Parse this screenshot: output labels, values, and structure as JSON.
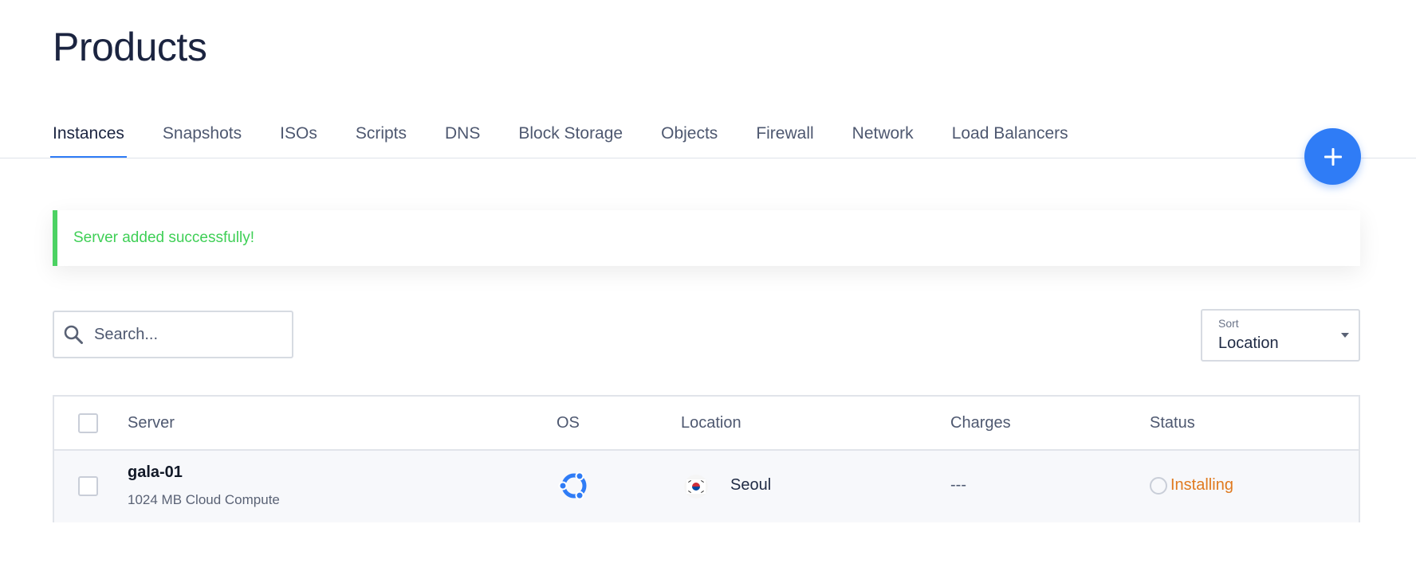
{
  "page": {
    "title": "Products"
  },
  "tabs": [
    {
      "label": "Instances",
      "active": true
    },
    {
      "label": "Snapshots",
      "active": false
    },
    {
      "label": "ISOs",
      "active": false
    },
    {
      "label": "Scripts",
      "active": false
    },
    {
      "label": "DNS",
      "active": false
    },
    {
      "label": "Block Storage",
      "active": false
    },
    {
      "label": "Objects",
      "active": false
    },
    {
      "label": "Firewall",
      "active": false
    },
    {
      "label": "Network",
      "active": false
    },
    {
      "label": "Load Balancers",
      "active": false
    }
  ],
  "fab": {
    "icon": "plus-icon",
    "color": "#2f7cf6"
  },
  "alert": {
    "message": "Server added successfully!",
    "color": "#4cd263"
  },
  "search": {
    "placeholder": "Search...",
    "value": "",
    "icon": "search-icon"
  },
  "sort": {
    "label": "Sort",
    "value": "Location"
  },
  "table": {
    "columns": [
      "Server",
      "OS",
      "Location",
      "Charges",
      "Status"
    ],
    "rows": [
      {
        "server_name": "gala-01",
        "server_plan": "1024 MB Cloud Compute",
        "os_icon": "ubuntu-icon",
        "flag_icon": "south-korea-flag-icon",
        "location": "Seoul",
        "charges": "---",
        "status": "Installing",
        "status_color": "#e07a1f"
      }
    ]
  }
}
